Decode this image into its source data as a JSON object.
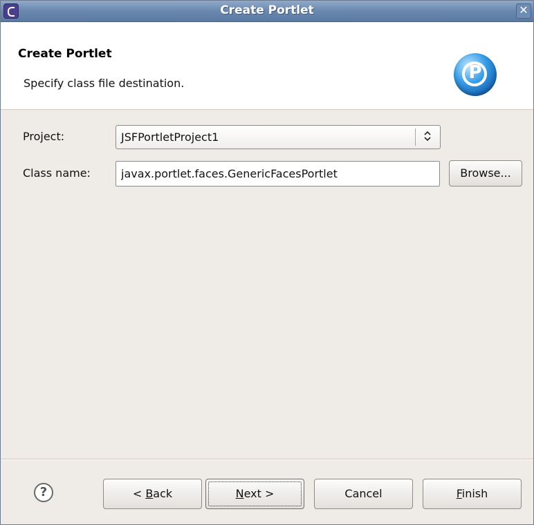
{
  "window": {
    "title": "Create Portlet",
    "close_glyph": "✕"
  },
  "header": {
    "title": "Create Portlet",
    "description": "Specify class file destination.",
    "logo_letter": "P"
  },
  "form": {
    "project_label": "Project:",
    "project_value": "JSFPortletProject1",
    "project_arrow": "⌃⌄",
    "classname_label": "Class name:",
    "classname_value": "javax.portlet.faces.GenericFacesPortlet",
    "browse_label": "Browse..."
  },
  "footer": {
    "help_glyph": "?",
    "back_prefix": "< ",
    "back_mnemonic": "B",
    "back_rest": "ack",
    "next_mnemonic": "N",
    "next_rest": "ext >",
    "cancel_label": "Cancel",
    "finish_mnemonic": "F",
    "finish_rest": "inish"
  },
  "icons": {
    "app": "eclipse-icon",
    "close": "close-icon",
    "logo": "portlet-logo-icon",
    "combo_arrow": "chevron-updown-icon",
    "help": "help-icon"
  }
}
